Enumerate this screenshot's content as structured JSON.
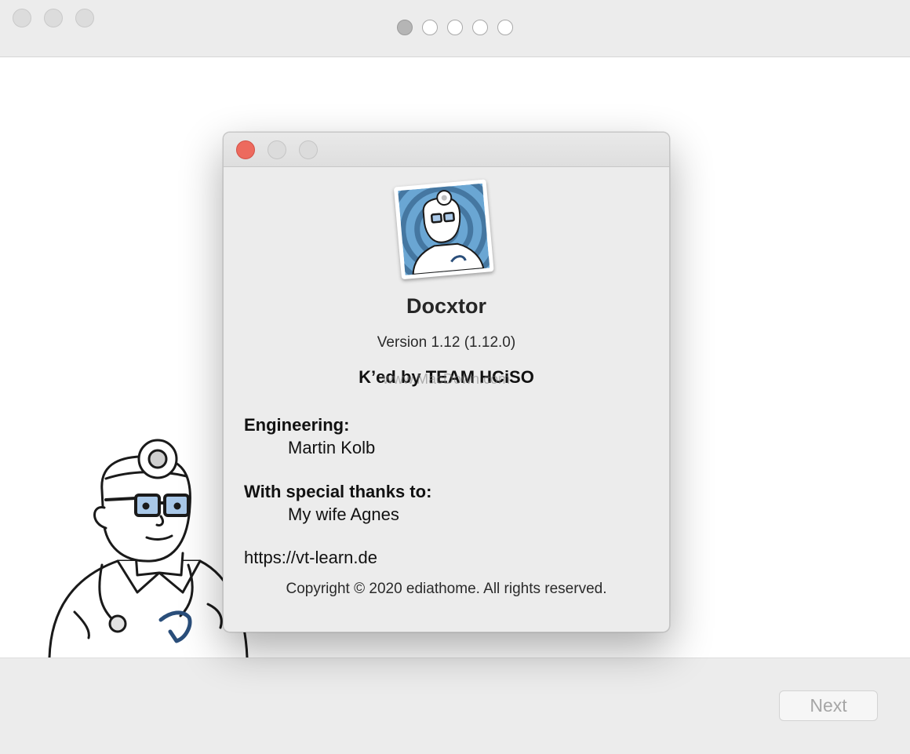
{
  "main_window": {
    "page_dots": {
      "count": 5,
      "active_index": 0
    },
    "next_button_label": "Next"
  },
  "about": {
    "app_name": "Docxtor",
    "version": "Version 1.12 (1.12.0)",
    "crack_line": "K’ed by TEAM HCiSO",
    "watermark": "www.MacDown.com",
    "engineering_heading": "Engineering:",
    "engineering_name": "Martin Kolb",
    "thanks_heading": "With special thanks to:",
    "thanks_name": "My wife Agnes",
    "url": "https://vt-learn.de",
    "copyright": "Copyright © 2020 ediathome. All rights reserved."
  },
  "colors": {
    "close_red": "#ed6a5e",
    "icon_blue": "#6aa6d3"
  }
}
